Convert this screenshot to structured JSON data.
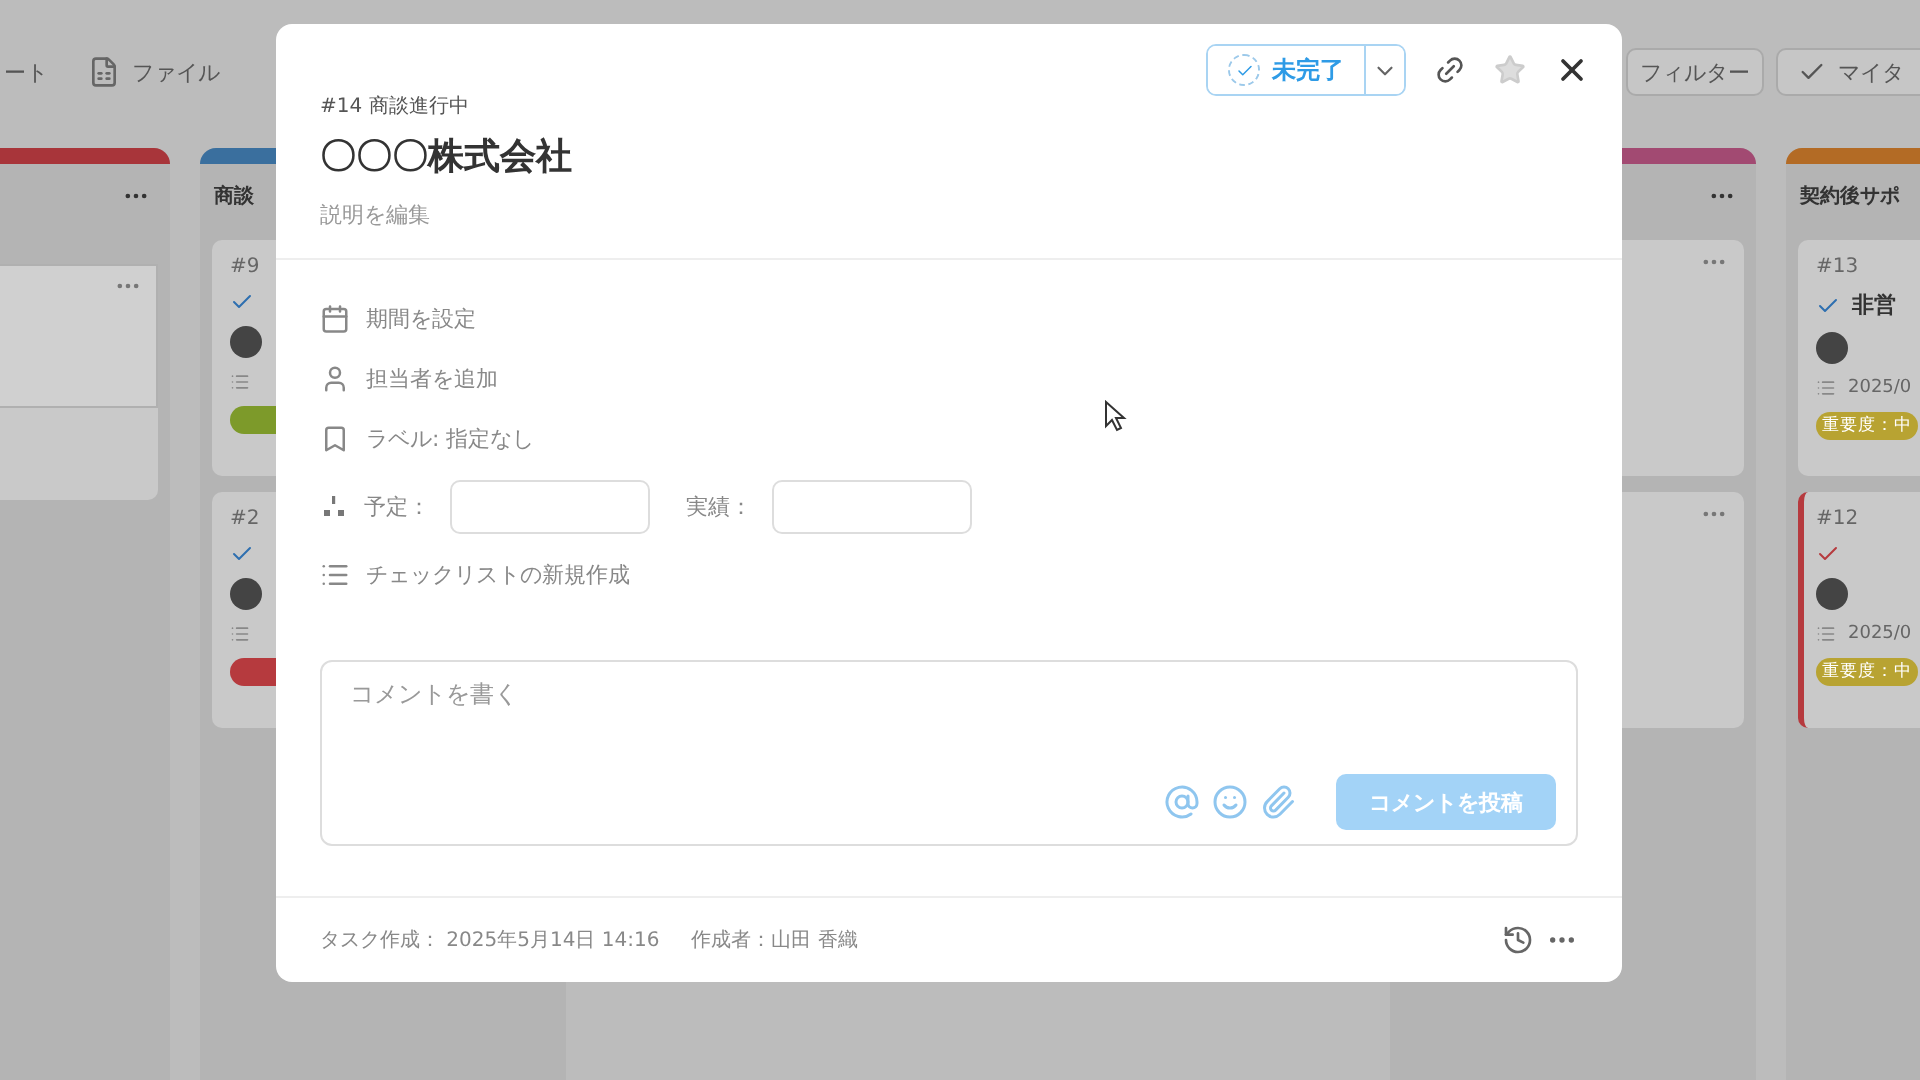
{
  "board": {
    "toolbar": {
      "left_items": [
        {
          "label": "ート"
        },
        {
          "label": "ファイル"
        }
      ],
      "right_items": [
        {
          "label": "フィルター",
          "kind": "filter"
        },
        {
          "label": "マイタ",
          "kind": "check"
        }
      ]
    },
    "left_columns": [
      {
        "color": "#a8353a",
        "cards": [
          {
            "kind": "screenshot"
          }
        ]
      },
      {
        "title": "商談",
        "color": "#3a6f9e",
        "cards": [
          {
            "kind": "task",
            "number": "#9",
            "color": "#7d9a2a",
            "flagged": false
          },
          {
            "kind": "task",
            "number": "#2",
            "color": "#b63a3e",
            "flagged": false
          }
        ]
      }
    ],
    "right_columns": [
      {
        "color": "#a24a72",
        "cards": [
          {
            "kind": "blank"
          },
          {
            "kind": "blank"
          }
        ]
      },
      {
        "title": "契約後サポ",
        "color": "#b36b25",
        "cards": [
          {
            "kind": "task",
            "number": "#13",
            "title": "非営",
            "date": "2025/0",
            "badge": "重要度：中",
            "color": "#b8a332",
            "flagged": false
          },
          {
            "kind": "task",
            "number": "#12",
            "date": "2025/0",
            "badge": "重要度：中",
            "color": "#b8a332",
            "flagged": true
          }
        ]
      }
    ]
  },
  "modal": {
    "task_number": "#14 商談進行中",
    "title": "〇〇〇株式会社",
    "description_link": "説明を編集",
    "status": {
      "label": "未完了",
      "completed": false
    },
    "starred": false,
    "fields": [
      {
        "kind": "period",
        "label": "期間を設定"
      },
      {
        "kind": "assignee",
        "label": "担当者を追加"
      },
      {
        "kind": "label",
        "label": "ラベル: 指定なし"
      },
      {
        "kind": "estimate",
        "planned_label": "予定：",
        "actual_label": "実績："
      },
      {
        "kind": "checklist",
        "label": "チェックリストの新規作成"
      }
    ],
    "comment": {
      "placeholder": "コメントを書く",
      "submit": "コメントを投稿",
      "submit_disabled": true
    },
    "footer": {
      "created": "タスク作成： 2025年5月14日 14:16",
      "author": "作成者：山田 香織"
    }
  }
}
